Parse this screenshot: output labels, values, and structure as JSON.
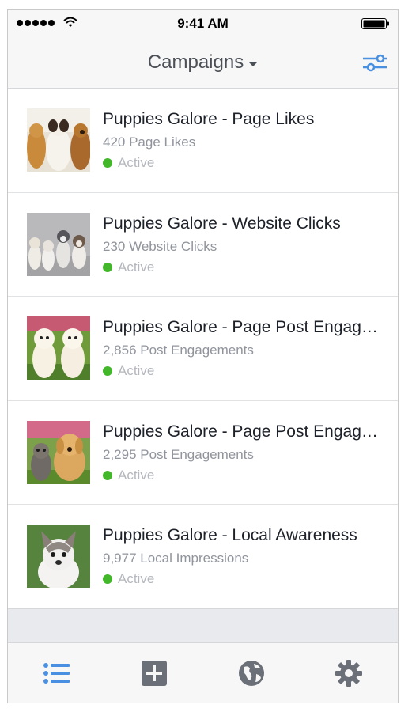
{
  "status_bar": {
    "time": "9:41 AM"
  },
  "nav": {
    "title": "Campaigns"
  },
  "campaigns": [
    {
      "title": "Puppies Galore - Page Likes",
      "metric": "420 Page Likes",
      "status": "Active"
    },
    {
      "title": "Puppies Galore - Website Clicks",
      "metric": "230 Website Clicks",
      "status": "Active"
    },
    {
      "title": "Puppies Galore - Page Post Engagement",
      "metric": "2,856 Post Engagements",
      "status": "Active"
    },
    {
      "title": "Puppies Galore - Page Post Engagement",
      "metric": "2,295 Post Engagements",
      "status": "Active"
    },
    {
      "title": "Puppies Galore - Local Awareness",
      "metric": "9,977 Local Impressions",
      "status": "Active"
    }
  ],
  "tabs": [
    {
      "icon": "list-icon",
      "active": true
    },
    {
      "icon": "add-icon",
      "active": false
    },
    {
      "icon": "globe-icon",
      "active": false
    },
    {
      "icon": "gear-icon",
      "active": false
    }
  ],
  "colors": {
    "accent": "#4a90e2",
    "inactive_icon": "#6b6f77",
    "status_active": "#42b72a"
  }
}
